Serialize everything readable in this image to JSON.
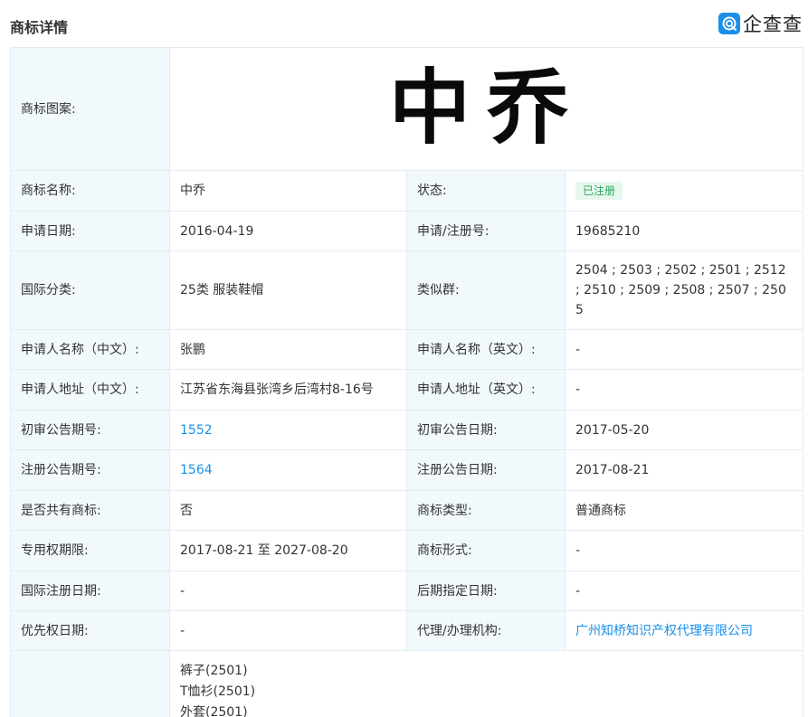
{
  "header": {
    "title": "商标详情",
    "brand_name": "企查查"
  },
  "colors": {
    "label_bg": "#f2f9fc",
    "border": "#e4ecf3",
    "link": "#1a8fe8",
    "badge_bg": "#e8f7ee",
    "badge_text": "#27a55b"
  },
  "trademark": {
    "image_label": "商标图案:",
    "image_text": "中乔",
    "name_label": "商标名称:",
    "name": "中乔",
    "status_label": "状态:",
    "status": "已注册",
    "apply_date_label": "申请日期:",
    "apply_date": "2016-04-19",
    "reg_no_label": "申请/注册号:",
    "reg_no": "19685210",
    "intl_class_label": "国际分类:",
    "intl_class": "25类 服装鞋帽",
    "similar_group_label": "类似群:",
    "similar_group": "2504 ; 2503 ; 2502 ; 2501 ; 2512 ; 2510 ; 2509 ; 2508 ; 2507 ; 2505",
    "applicant_cn_label": "申请人名称（中文）:",
    "applicant_cn": "张鹏",
    "applicant_en_label": "申请人名称（英文）:",
    "applicant_en": "-",
    "address_cn_label": "申请人地址（中文）:",
    "address_cn": "江苏省东海县张湾乡后湾村8-16号",
    "address_en_label": "申请人地址（英文）:",
    "address_en": "-",
    "prelim_issue_label": "初审公告期号:",
    "prelim_issue": "1552",
    "prelim_date_label": "初审公告日期:",
    "prelim_date": "2017-05-20",
    "reg_issue_label": "注册公告期号:",
    "reg_issue": "1564",
    "reg_date_label": "注册公告日期:",
    "reg_date": "2017-08-21",
    "shared_label": "是否共有商标:",
    "shared": "否",
    "tm_type_label": "商标类型:",
    "tm_type": "普通商标",
    "exclusive_period_label": "专用权期限:",
    "exclusive_period": "2017-08-21 至 2027-08-20",
    "tm_form_label": "商标形式:",
    "tm_form": "-",
    "intl_reg_date_label": "国际注册日期:",
    "intl_reg_date": "-",
    "later_designation_label": "后期指定日期:",
    "later_designation": "-",
    "priority_date_label": "优先权日期:",
    "priority_date": "-",
    "agent_label": "代理/办理机构:",
    "agent": "广州知桥知识产权代理有限公司",
    "goods": [
      "裤子(2501)",
      "T恤衫(2501)",
      "外套(2501)"
    ]
  }
}
